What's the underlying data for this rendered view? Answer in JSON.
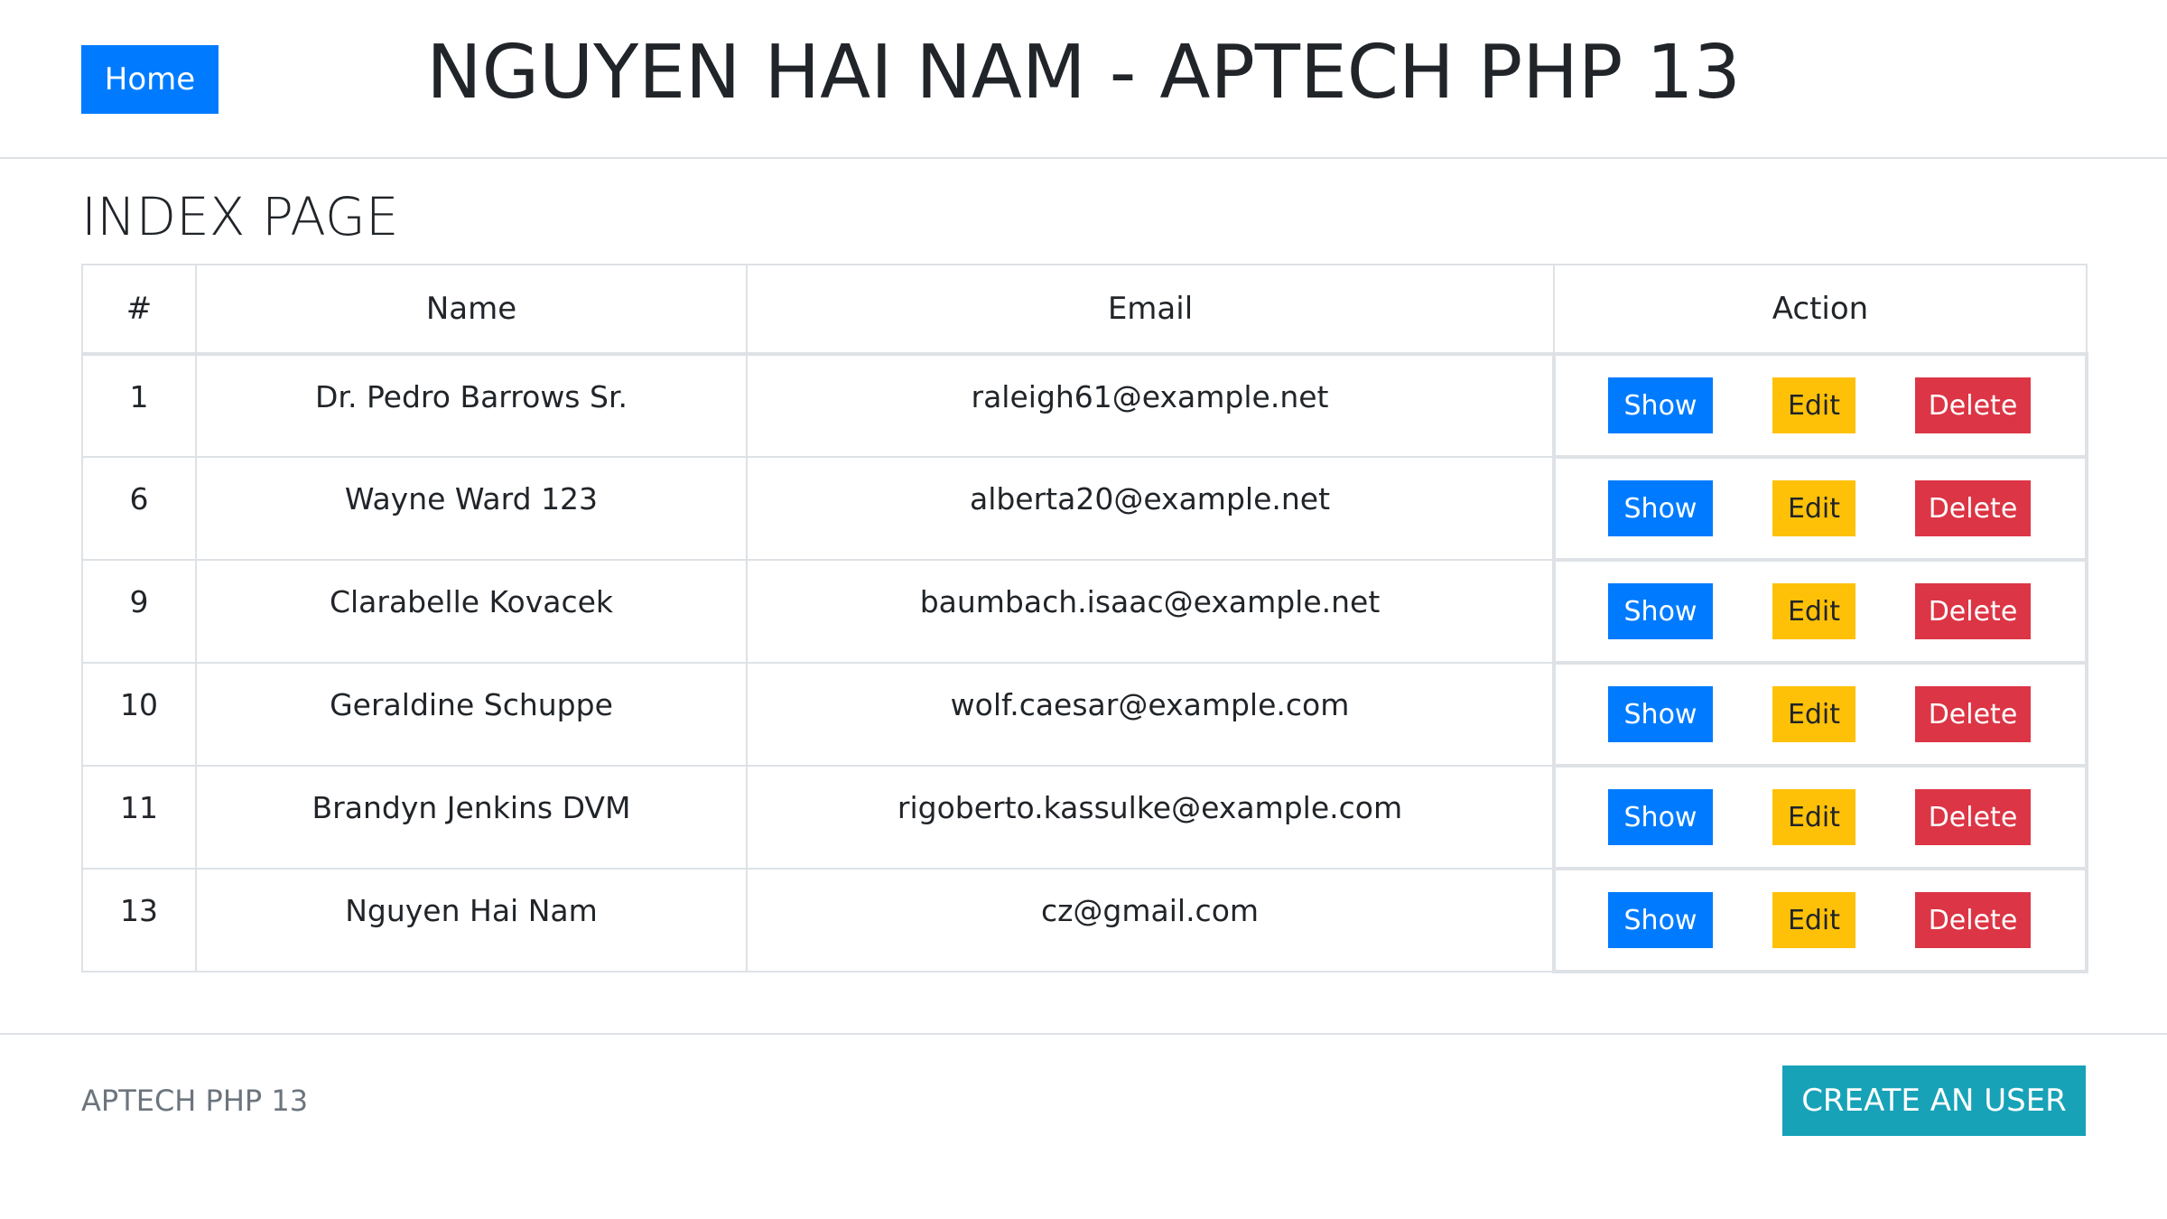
{
  "header": {
    "home_label": "Home",
    "title": "NGUYEN HAI NAM - APTECH PHP 13"
  },
  "page": {
    "title": "INDEX PAGE"
  },
  "table": {
    "columns": [
      "#",
      "Name",
      "Email",
      "Action"
    ],
    "rows": [
      {
        "id": "1",
        "name": "Dr. Pedro Barrows Sr.",
        "email": "raleigh61@example.net"
      },
      {
        "id": "6",
        "name": "Wayne Ward 123",
        "email": "alberta20@example.net"
      },
      {
        "id": "9",
        "name": "Clarabelle Kovacek",
        "email": "baumbach.isaac@example.net"
      },
      {
        "id": "10",
        "name": "Geraldine Schuppe",
        "email": "wolf.caesar@example.com"
      },
      {
        "id": "11",
        "name": "Brandyn Jenkins DVM",
        "email": "rigoberto.kassulke@example.com"
      },
      {
        "id": "13",
        "name": "Nguyen Hai Nam",
        "email": "cz@gmail.com"
      }
    ],
    "actions": {
      "show_label": "Show",
      "edit_label": "Edit",
      "delete_label": "Delete"
    }
  },
  "footer": {
    "text": "APTECH PHP 13",
    "create_label": "CREATE AN USER"
  },
  "colors": {
    "primary": "#007bff",
    "warning": "#ffc107",
    "danger": "#dc3545",
    "info": "#17a2b8",
    "border": "#dee2e6",
    "muted": "#6c757d"
  }
}
